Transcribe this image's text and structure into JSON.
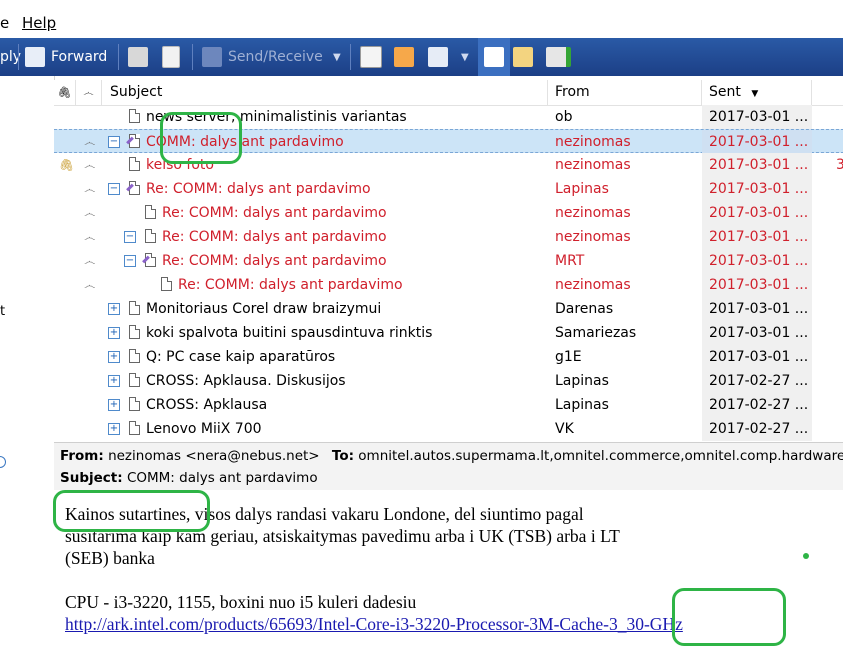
{
  "menu": {
    "items": [
      {
        "label": "e"
      },
      {
        "label": "Help"
      }
    ]
  },
  "toolbar": {
    "reply_label": "ply",
    "forward_label": "Forward",
    "send_receive_label": "Send/Receive"
  },
  "left_pane": {
    "marker": "t"
  },
  "list": {
    "columns": {
      "attach": "",
      "flag": "",
      "subject": "Subject",
      "from": "From",
      "sent": "Sent"
    },
    "rows": [
      {
        "subject": "news server, minimalistinis variantas",
        "from": "ob",
        "sent": "2017-03-01 ..."
      },
      {
        "subject": "COMM: dalys ant pardavimo",
        "from": "nezinomas",
        "sent": "2017-03-01 ..."
      },
      {
        "subject": "kelso foto",
        "from": "nezinomas",
        "sent": "2017-03-01 ...",
        "extra": "3"
      },
      {
        "subject": "Re: COMM: dalys ant pardavimo",
        "from": "Lapinas",
        "sent": "2017-03-01 ..."
      },
      {
        "subject": "Re: COMM: dalys ant pardavimo",
        "from": "nezinomas",
        "sent": "2017-03-01 ..."
      },
      {
        "subject": "Re: COMM: dalys ant pardavimo",
        "from": "nezinomas",
        "sent": "2017-03-01 ..."
      },
      {
        "subject": "Re: COMM: dalys ant pardavimo",
        "from": "MRT",
        "sent": "2017-03-01 ..."
      },
      {
        "subject": "Re: COMM: dalys ant pardavimo",
        "from": "nezinomas",
        "sent": "2017-03-01 ..."
      },
      {
        "subject": "Monitoriaus Corel draw braizymui",
        "from": "Darenas",
        "sent": "2017-03-01 ..."
      },
      {
        "subject": "koki spalvota buitini spausdintuva rinktis",
        "from": "Samariezas",
        "sent": "2017-03-01 ..."
      },
      {
        "subject": "Q: PC case kaip aparatūros",
        "from": "g1E",
        "sent": "2017-03-01 ..."
      },
      {
        "subject": "CROSS: Apklausa. Diskusijos",
        "from": "Lapinas",
        "sent": "2017-02-27 ..."
      },
      {
        "subject": "CROSS: Apklausa",
        "from": "Lapinas",
        "sent": "2017-02-27 ..."
      },
      {
        "subject": "Lenovo MiiX 700",
        "from": "VK",
        "sent": "2017-02-27 ..."
      }
    ]
  },
  "preview": {
    "from_label": "From:",
    "from_value": "nezinomas <nera@nebus.net>",
    "to_label": "To:",
    "to_value": "omnitel.autos.supermama.lt,omnitel.commerce,omnitel.comp.hardware",
    "subject_label": "Subject:",
    "subject_value": "COMM: dalys ant pardavimo",
    "body_line1": "Kainos sutartines, visos dalys randasi vakaru Londone, del siuntimo pagal",
    "body_line2": "susitarima kaip kam geriau, atsiskaitymas pavedimu arba i UK (TSB) arba i LT",
    "body_line3": "(SEB) banka",
    "body_line4": "CPU - i3-3220, 1155, boxini nuo i5 kuleri dadesiu",
    "body_link": "http://ark.intel.com/products/65693/Intel-Core-i3-3220-Processor-3M-Cache-3_30-GHz"
  },
  "colors": {
    "toolbar_bg": "#1c3f86",
    "unread_red": "#d0202c",
    "annotation_green": "#2eb446",
    "selection": "#cce4f7"
  }
}
